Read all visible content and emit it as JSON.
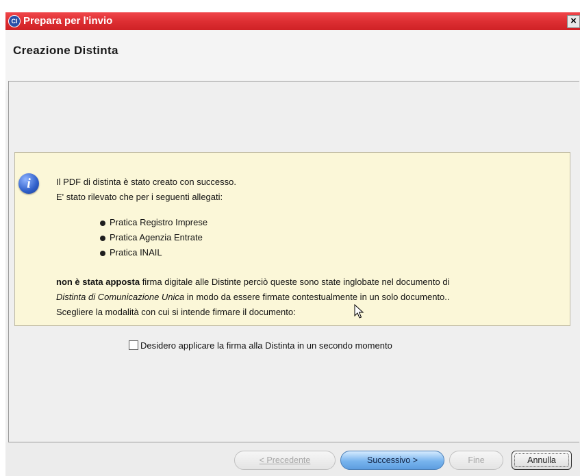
{
  "window": {
    "title": "Prepara per l'invio",
    "app_icon_text": "CI",
    "close_label": "×"
  },
  "header": {
    "page_title": "Creazione Distinta"
  },
  "info": {
    "line1": "Il PDF di distinta è stato creato con successo.",
    "line2": "E' stato rilevato che per i seguenti allegati:",
    "bullets": [
      "Pratica Registro Imprese",
      "Pratica Agenzia Entrate",
      "Pratica INAIL"
    ],
    "bold_part": "non è stata apposta",
    "line3_rest": " firma digitale alle Distinte perciò queste sono state inglobate nel documento di",
    "italic_part": "Distinta di Comunicazione Unica",
    "line4_rest": " in modo da essere firmate contestualmente in un solo documento..",
    "line5": "Scegliere la modalità con cui si intende firmare il documento:"
  },
  "checkbox": {
    "label": "Desidero applicare la firma alla Distinta in un secondo momento",
    "checked": false
  },
  "buttons": {
    "previous": "< Precedente",
    "next": "Successivo >",
    "finish": "Fine",
    "cancel": "Annulla"
  },
  "colors": {
    "titlebar": "#dc2d31",
    "info_background": "#fbf7d8",
    "primary_button": "#78b4ee"
  },
  "icons": {
    "info": "info-icon",
    "app": "ci-logo-icon",
    "close": "close-icon"
  }
}
